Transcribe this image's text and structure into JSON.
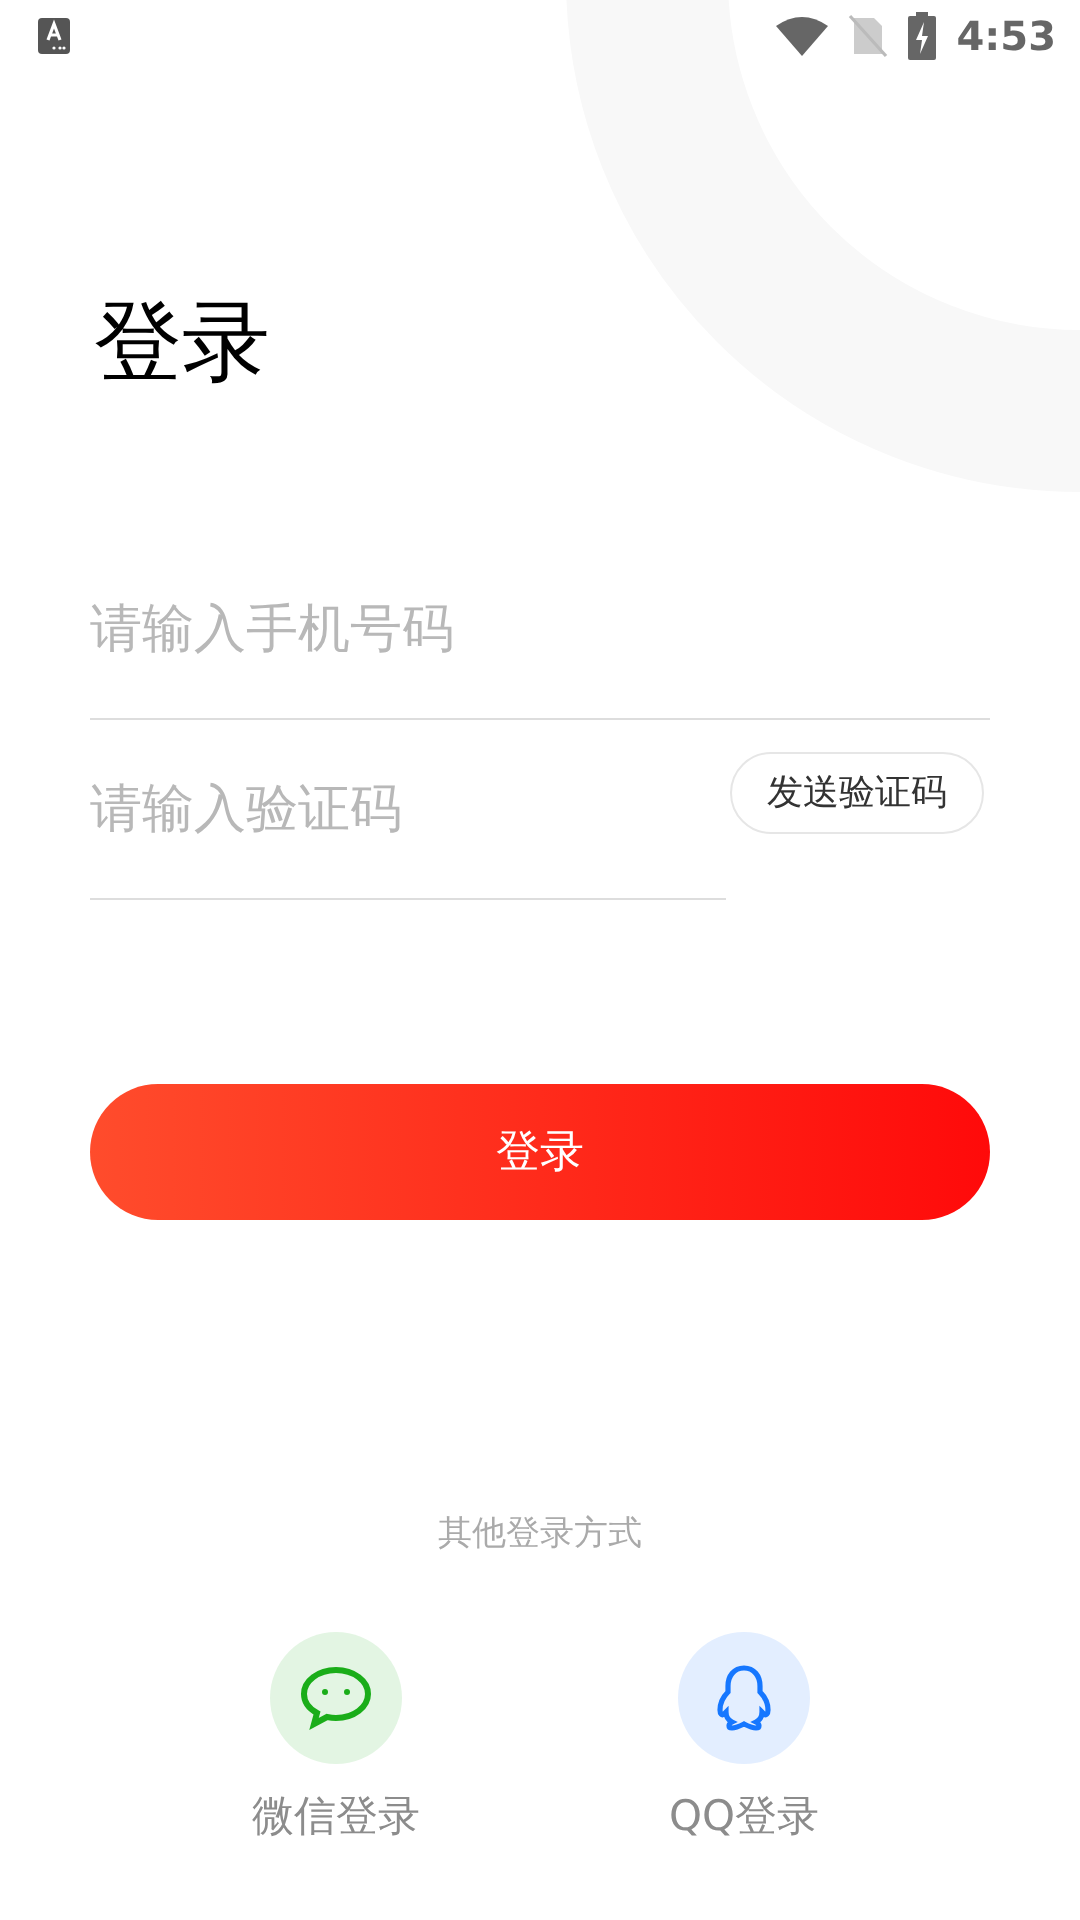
{
  "status_bar": {
    "time": "4:53"
  },
  "title": "登录",
  "fields": [
    {
      "placeholder": "请输入手机号码"
    },
    {
      "placeholder": "请输入验证码",
      "action": "发送验证码"
    }
  ],
  "login_button": "登录",
  "other_login": {
    "heading": "其他登录方式",
    "options": [
      {
        "kind": "wechat",
        "label": "微信登录",
        "color": "#1aad19"
      },
      {
        "kind": "qq",
        "label": "QQ登录",
        "color": "#1677ff"
      }
    ]
  }
}
